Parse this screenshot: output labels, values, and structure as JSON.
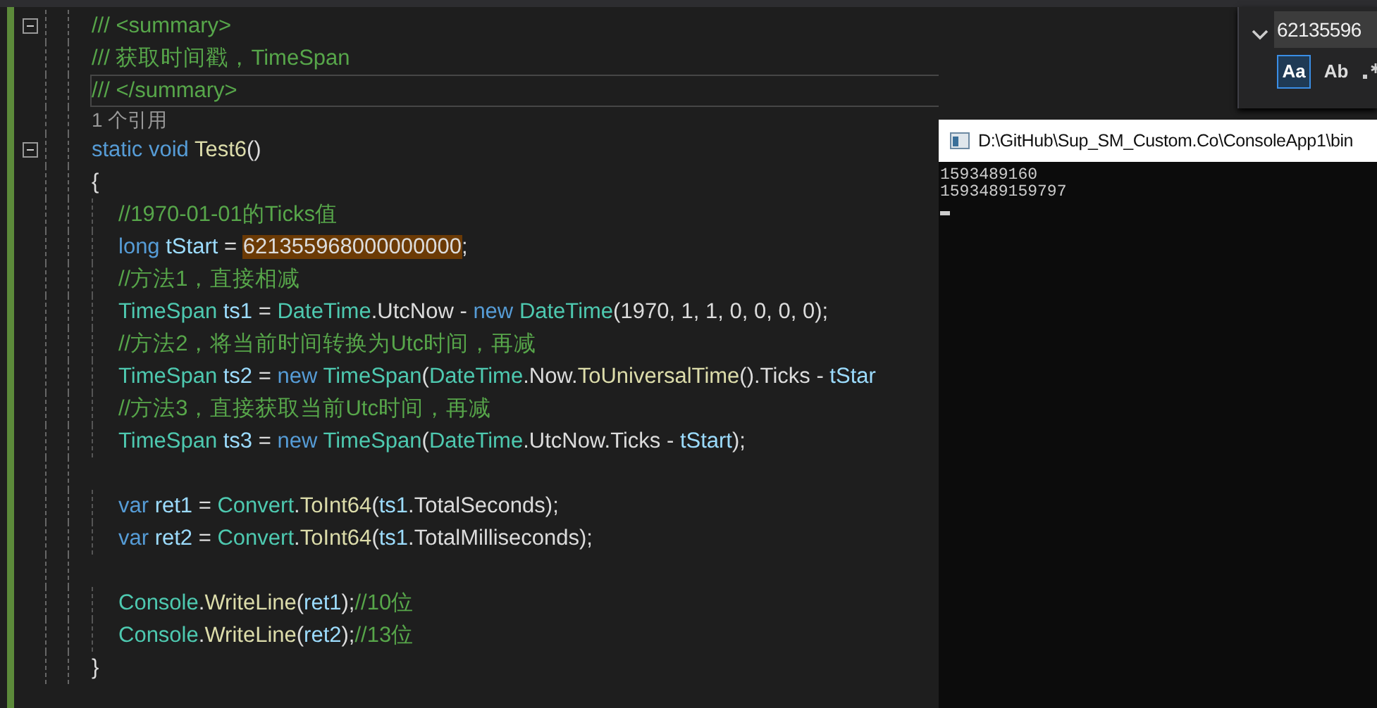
{
  "editor": {
    "lines": [
      {
        "kind": "code",
        "fold": true,
        "indented": false,
        "tokens": [
          {
            "kind": "comment",
            "text": "/// <summary>"
          }
        ]
      },
      {
        "kind": "code",
        "indented": false,
        "tokens": [
          {
            "kind": "comment",
            "text": "/// 获取时间戳，TimeSpan"
          }
        ]
      },
      {
        "kind": "code",
        "indented": false,
        "current": true,
        "tokens": [
          {
            "kind": "comment",
            "text": "/// </summary>"
          }
        ]
      },
      {
        "kind": "codelens",
        "text": "1 个引用"
      },
      {
        "kind": "code",
        "fold": true,
        "indented": false,
        "tokens": [
          {
            "kind": "keyword",
            "text": "static "
          },
          {
            "kind": "keyword",
            "text": "void "
          },
          {
            "kind": "method",
            "text": "Test6"
          },
          {
            "kind": "plain",
            "text": "()"
          }
        ]
      },
      {
        "kind": "code",
        "indented": false,
        "tokens": [
          {
            "kind": "plain",
            "text": "{"
          }
        ]
      },
      {
        "kind": "code",
        "indented": true,
        "tokens": [
          {
            "kind": "comment",
            "text": "//1970-01-01的Ticks值"
          }
        ]
      },
      {
        "kind": "code",
        "indented": true,
        "tokens": [
          {
            "kind": "keyword",
            "text": "long "
          },
          {
            "kind": "var",
            "text": "tStart"
          },
          {
            "kind": "plain",
            "text": " = "
          },
          {
            "kind": "found",
            "text": "621355968000000000"
          },
          {
            "kind": "plain",
            "text": ";"
          }
        ]
      },
      {
        "kind": "code",
        "indented": true,
        "tokens": [
          {
            "kind": "comment",
            "text": "//方法1，直接相减"
          }
        ]
      },
      {
        "kind": "code",
        "indented": true,
        "tokens": [
          {
            "kind": "type",
            "text": "TimeSpan "
          },
          {
            "kind": "var",
            "text": "ts1"
          },
          {
            "kind": "plain",
            "text": " = "
          },
          {
            "kind": "type",
            "text": "DateTime"
          },
          {
            "kind": "plain",
            "text": ".UtcNow - "
          },
          {
            "kind": "keyword",
            "text": "new "
          },
          {
            "kind": "type",
            "text": "DateTime"
          },
          {
            "kind": "plain",
            "text": "(1970, 1, 1, 0, 0, 0, 0);"
          }
        ]
      },
      {
        "kind": "code",
        "indented": true,
        "tokens": [
          {
            "kind": "comment",
            "text": "//方法2，将当前时间转换为Utc时间，再减"
          }
        ]
      },
      {
        "kind": "code",
        "indented": true,
        "tokens": [
          {
            "kind": "type",
            "text": "TimeSpan "
          },
          {
            "kind": "var",
            "text": "ts2"
          },
          {
            "kind": "plain",
            "text": " = "
          },
          {
            "kind": "keyword",
            "text": "new "
          },
          {
            "kind": "type",
            "text": "TimeSpan"
          },
          {
            "kind": "plain",
            "text": "("
          },
          {
            "kind": "type",
            "text": "DateTime"
          },
          {
            "kind": "plain",
            "text": ".Now."
          },
          {
            "kind": "method",
            "text": "ToUniversalTime"
          },
          {
            "kind": "plain",
            "text": "().Ticks - "
          },
          {
            "kind": "var",
            "text": "tStar"
          }
        ]
      },
      {
        "kind": "code",
        "indented": true,
        "tokens": [
          {
            "kind": "comment",
            "text": "//方法3，直接获取当前Utc时间，再减"
          }
        ]
      },
      {
        "kind": "code",
        "indented": true,
        "tokens": [
          {
            "kind": "type",
            "text": "TimeSpan "
          },
          {
            "kind": "var",
            "text": "ts3"
          },
          {
            "kind": "plain",
            "text": " = "
          },
          {
            "kind": "keyword",
            "text": "new "
          },
          {
            "kind": "type",
            "text": "TimeSpan"
          },
          {
            "kind": "plain",
            "text": "("
          },
          {
            "kind": "type",
            "text": "DateTime"
          },
          {
            "kind": "plain",
            "text": ".UtcNow.Ticks - "
          },
          {
            "kind": "var",
            "text": "tStart"
          },
          {
            "kind": "plain",
            "text": ");"
          }
        ]
      },
      {
        "kind": "blank"
      },
      {
        "kind": "code",
        "indented": true,
        "tokens": [
          {
            "kind": "keyword",
            "text": "var "
          },
          {
            "kind": "var",
            "text": "ret1"
          },
          {
            "kind": "plain",
            "text": " = "
          },
          {
            "kind": "type",
            "text": "Convert"
          },
          {
            "kind": "plain",
            "text": "."
          },
          {
            "kind": "method",
            "text": "ToInt64"
          },
          {
            "kind": "plain",
            "text": "("
          },
          {
            "kind": "var",
            "text": "ts1"
          },
          {
            "kind": "plain",
            "text": ".TotalSeconds);"
          }
        ]
      },
      {
        "kind": "code",
        "indented": true,
        "tokens": [
          {
            "kind": "keyword",
            "text": "var "
          },
          {
            "kind": "var",
            "text": "ret2"
          },
          {
            "kind": "plain",
            "text": " = "
          },
          {
            "kind": "type",
            "text": "Convert"
          },
          {
            "kind": "plain",
            "text": "."
          },
          {
            "kind": "method",
            "text": "ToInt64"
          },
          {
            "kind": "plain",
            "text": "("
          },
          {
            "kind": "var",
            "text": "ts1"
          },
          {
            "kind": "plain",
            "text": ".TotalMilliseconds);"
          }
        ]
      },
      {
        "kind": "blank"
      },
      {
        "kind": "code",
        "indented": true,
        "tokens": [
          {
            "kind": "type",
            "text": "Console"
          },
          {
            "kind": "plain",
            "text": "."
          },
          {
            "kind": "method",
            "text": "WriteLine"
          },
          {
            "kind": "plain",
            "text": "("
          },
          {
            "kind": "var",
            "text": "ret1"
          },
          {
            "kind": "plain",
            "text": ");"
          },
          {
            "kind": "comment",
            "text": "//10位"
          }
        ]
      },
      {
        "kind": "code",
        "indented": true,
        "tokens": [
          {
            "kind": "type",
            "text": "Console"
          },
          {
            "kind": "plain",
            "text": "."
          },
          {
            "kind": "method",
            "text": "WriteLine"
          },
          {
            "kind": "plain",
            "text": "("
          },
          {
            "kind": "var",
            "text": "ret2"
          },
          {
            "kind": "plain",
            "text": ");"
          },
          {
            "kind": "comment",
            "text": "//13位"
          }
        ]
      },
      {
        "kind": "code",
        "indented": false,
        "tokens": [
          {
            "kind": "plain",
            "text": "}"
          }
        ]
      }
    ]
  },
  "find_widget": {
    "query": "62135596",
    "options": [
      {
        "label": "Aa",
        "selected": true
      },
      {
        "label": "Ab",
        "selected": false
      }
    ]
  },
  "console_window": {
    "title": "D:\\GitHub\\Sup_SM_Custom.Co\\ConsoleApp1\\bin",
    "output": [
      "1593489160",
      "1593489159797"
    ]
  }
}
